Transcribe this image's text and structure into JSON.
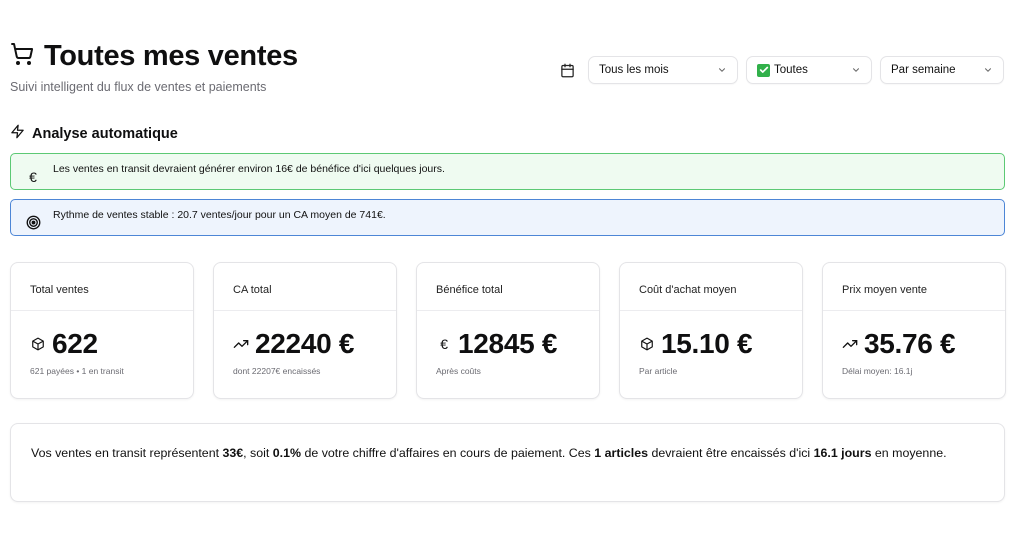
{
  "header": {
    "title": "Toutes mes ventes",
    "subtitle": "Suivi intelligent du flux de ventes et paiements"
  },
  "filters": {
    "month": "Tous les mois",
    "status": "Toutes",
    "period": "Par semaine"
  },
  "analysis": {
    "title": "Analyse automatique",
    "alerts": [
      {
        "icon": "euro-icon",
        "text": "Les ventes en transit devraient générer environ 16€ de bénéfice d'ici quelques jours."
      },
      {
        "icon": "target-icon",
        "text": "Rythme de ventes stable : 20.7 ventes/jour pour un CA moyen de 741€."
      }
    ]
  },
  "cards": [
    {
      "label": "Total ventes",
      "value": "622",
      "sub": "621 payées • 1 en transit",
      "icon": "package-icon"
    },
    {
      "label": "CA total",
      "value": "22240 €",
      "sub": "dont 22207€ encaissés",
      "icon": "trending-up-icon"
    },
    {
      "label": "Bénéfice total",
      "value": "12845 €",
      "sub": "Après coûts",
      "icon": "euro-icon"
    },
    {
      "label": "Coût d'achat moyen",
      "value": "15.10 €",
      "sub": "Par article",
      "icon": "package-icon"
    },
    {
      "label": "Prix moyen vente",
      "value": "35.76 €",
      "sub": "Délai moyen: 16.1j",
      "icon": "trending-up-icon"
    }
  ],
  "summary": {
    "t1": "Vos ventes en transit représentent ",
    "b1": "33€",
    "t2": ", soit ",
    "b2": "0.1%",
    "t3": " de votre chiffre d'affaires en cours de paiement. Ces ",
    "b3": "1 articles",
    "t4": " devraient être encaissés d'ici ",
    "b4": "16.1 jours",
    "t5": " en moyenne."
  }
}
